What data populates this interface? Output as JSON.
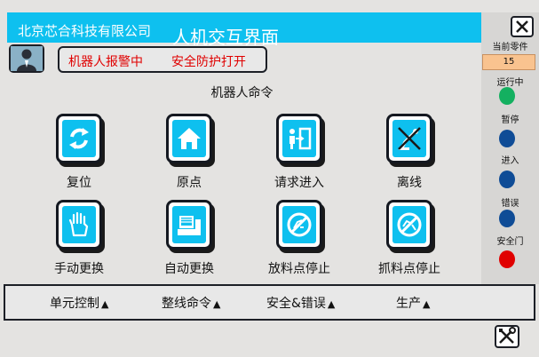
{
  "header": {
    "company": "北京芯合科技有限公司",
    "title": "人机交互界面"
  },
  "alarm": {
    "robot_alarm": "机器人报警中",
    "safety_protection": "安全防护打开"
  },
  "commands": {
    "title": "机器人命令",
    "items": [
      {
        "label": "复位",
        "icon": "refresh-icon"
      },
      {
        "label": "原点",
        "icon": "home-icon"
      },
      {
        "label": "请求进入",
        "icon": "enter-door-icon"
      },
      {
        "label": "离线",
        "icon": "offline-robot-icon"
      },
      {
        "label": "手动更换",
        "icon": "hand-icon"
      },
      {
        "label": "自动更换",
        "icon": "auto-machine-icon"
      },
      {
        "label": "放料点停止",
        "icon": "stop-place-icon"
      },
      {
        "label": "抓料点停止",
        "icon": "stop-pick-icon"
      }
    ]
  },
  "status": {
    "current_part_label": "当前零件",
    "current_part_value": "15",
    "running": "运行中",
    "paused": "暂停",
    "entering": "进入",
    "error": "错误",
    "safety_door": "安全门",
    "colors": {
      "running": "#14b060",
      "paused": "#0f4c96",
      "entering": "#0f4c96",
      "error": "#0f4c96",
      "safety_door": "#e00000"
    }
  },
  "nav": {
    "unit_control": "单元控制",
    "line_command": "整线命令",
    "safety_error": "安全&错误",
    "production": "生产",
    "arrow": "▲"
  },
  "colors": {
    "accent": "#0ec0ef",
    "alarm_text": "#e00000"
  }
}
